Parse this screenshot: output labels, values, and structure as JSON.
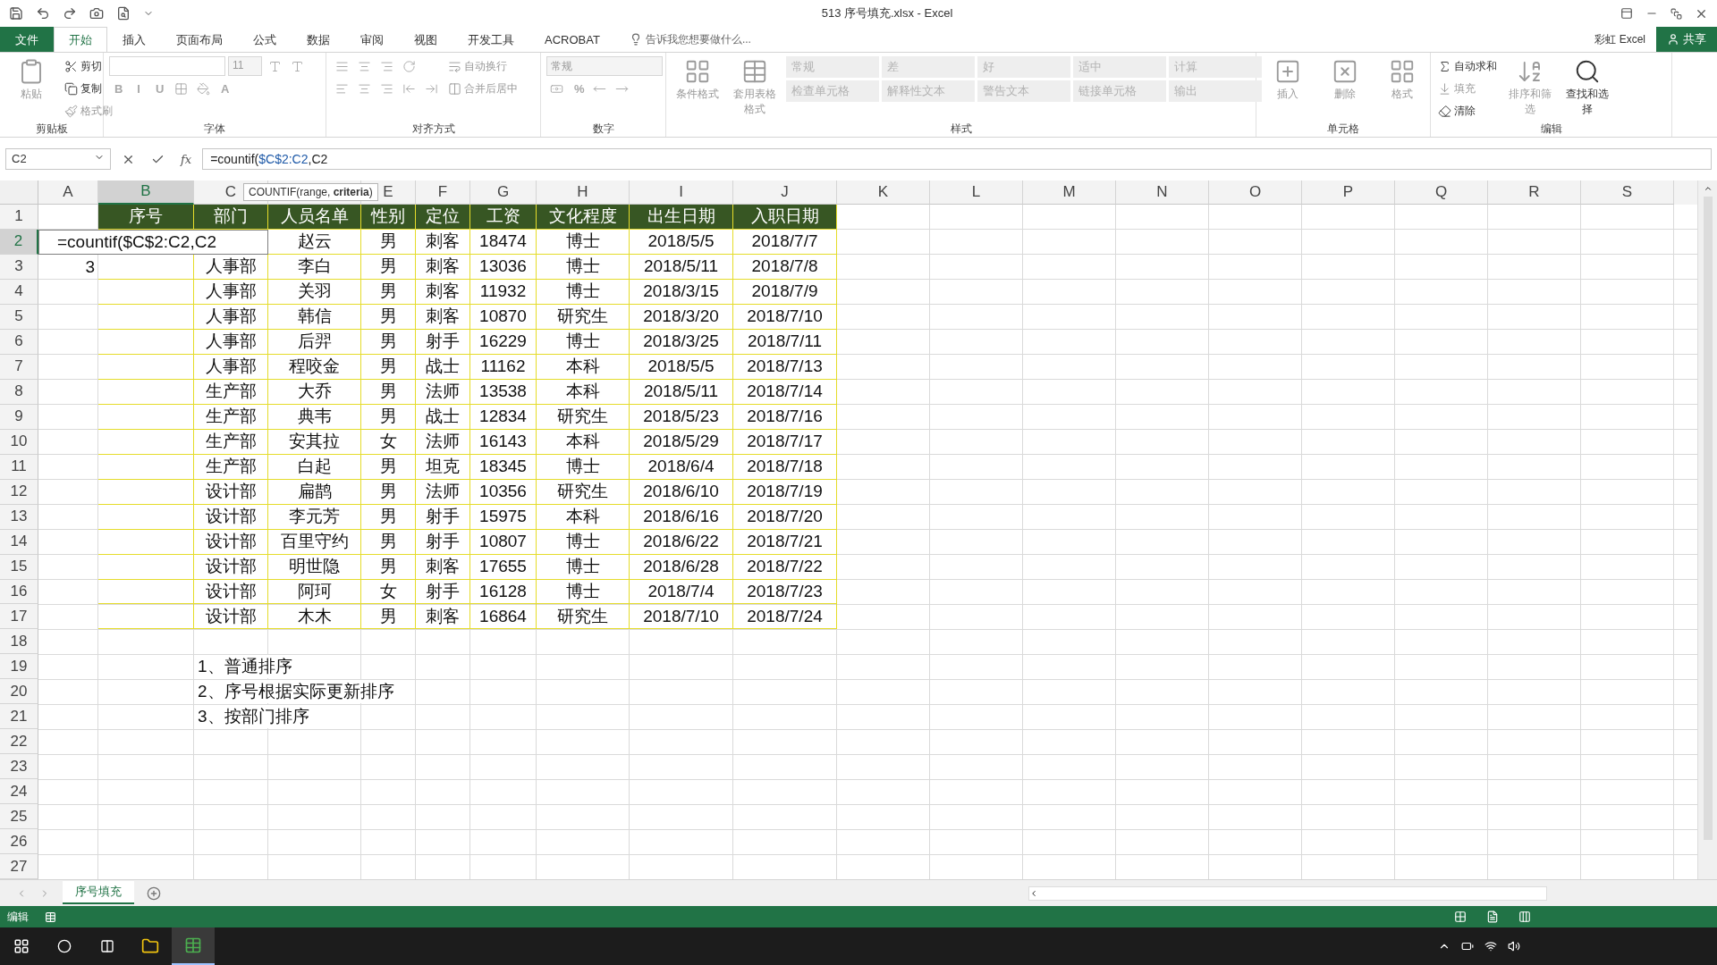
{
  "title": "513 序号填充.xlsx - Excel",
  "menu_tabs": [
    {
      "label": "文件",
      "kind": "file",
      "selected": false
    },
    {
      "label": "开始",
      "kind": "tab",
      "selected": true
    },
    {
      "label": "插入",
      "kind": "tab",
      "selected": false
    },
    {
      "label": "页面布局",
      "kind": "tab",
      "selected": false
    },
    {
      "label": "公式",
      "kind": "tab",
      "selected": false
    },
    {
      "label": "数据",
      "kind": "tab",
      "selected": false
    },
    {
      "label": "审阅",
      "kind": "tab",
      "selected": false
    },
    {
      "label": "视图",
      "kind": "tab",
      "selected": false
    },
    {
      "label": "开发工具",
      "kind": "tab",
      "selected": false
    },
    {
      "label": "ACROBAT",
      "kind": "tab",
      "selected": false
    }
  ],
  "tell_me": {
    "placeholder": "告诉我您想要做什么..."
  },
  "account": "彩虹 Excel",
  "share": "共享",
  "ribbon": [
    {
      "label": "剪贴板",
      "columns": [
        [
          [
            {
              "kind": "large",
              "label": "粘贴",
              "disabled": true
            }
          ]
        ],
        [
          [
            {
              "kind": "small",
              "label": "剪切",
              "disabled": false
            }
          ],
          [
            {
              "kind": "small",
              "label": "复制",
              "disabled": false
            }
          ],
          [
            {
              "kind": "small",
              "label": "格式刷",
              "disabled": true
            }
          ]
        ]
      ]
    },
    {
      "label": "字体",
      "columns": [
        [
          [
            {
              "kind": "field-wide"
            },
            {
              "kind": "field",
              "value": "11",
              "disabled": true
            },
            {
              "kind": "icon",
              "disabled": true
            },
            {
              "kind": "icon",
              "disabled": true
            }
          ],
          [
            {
              "kind": "char",
              "label": "B",
              "disabled": true
            },
            {
              "kind": "char",
              "label": "I",
              "disabled": true
            },
            {
              "kind": "char",
              "label": "U",
              "disabled": true
            },
            {
              "kind": "icon",
              "disabled": true
            },
            {
              "kind": "icon",
              "disabled": true
            },
            {
              "kind": "char",
              "label": "A",
              "disabled": true
            }
          ]
        ]
      ]
    },
    {
      "label": "对齐方式",
      "columns": [
        [
          [
            {
              "kind": "icon",
              "disabled": true
            },
            {
              "kind": "icon",
              "disabled": true
            },
            {
              "kind": "icon",
              "disabled": true
            },
            {
              "kind": "icon",
              "disabled": true
            }
          ],
          [
            {
              "kind": "icon",
              "disabled": true
            },
            {
              "kind": "icon",
              "disabled": true
            },
            {
              "kind": "icon",
              "disabled": true
            },
            {
              "kind": "icon",
              "disabled": true
            },
            {
              "kind": "icon",
              "disabled": true
            }
          ]
        ],
        [
          [
            {
              "kind": "small",
              "label": "自动换行",
              "disabled": true
            }
          ],
          [
            {
              "kind": "small",
              "label": "合并后居中",
              "disabled": true
            }
          ]
        ]
      ]
    },
    {
      "label": "数字",
      "columns": [
        [
          [
            {
              "kind": "field-wide",
              "value": "常规",
              "disabled": true
            }
          ],
          [
            {
              "kind": "icon",
              "disabled": true
            },
            {
              "kind": "char",
              "label": "%",
              "disabled": true
            },
            {
              "kind": "icon",
              "disabled": true
            },
            {
              "kind": "icon",
              "disabled": true
            }
          ]
        ]
      ]
    },
    {
      "label": "样式",
      "columns": [
        [
          [
            {
              "kind": "large",
              "label": "条件格式",
              "disabled": true
            }
          ]
        ],
        [
          [
            {
              "kind": "large",
              "label": "套用表格格式",
              "disabled": true
            }
          ]
        ],
        [
          [
            {
              "kind": "style",
              "label": "常规",
              "disabled": true
            },
            {
              "kind": "style",
              "label": "差",
              "disabled": true
            },
            {
              "kind": "style",
              "label": "好",
              "disabled": true
            },
            {
              "kind": "style",
              "label": "适中",
              "disabled": true
            },
            {
              "kind": "style",
              "label": "计算",
              "disabled": true
            }
          ],
          [
            {
              "kind": "style",
              "label": "检查单元格",
              "disabled": true
            },
            {
              "kind": "style",
              "label": "解释性文本",
              "disabled": true
            },
            {
              "kind": "style",
              "label": "警告文本",
              "disabled": true
            },
            {
              "kind": "style",
              "label": "链接单元格",
              "disabled": true
            },
            {
              "kind": "style",
              "label": "输出",
              "disabled": true
            }
          ]
        ]
      ]
    },
    {
      "label": "单元格",
      "columns": [
        [
          [
            {
              "kind": "large",
              "label": "插入",
              "disabled": true
            }
          ]
        ],
        [
          [
            {
              "kind": "large",
              "label": "删除",
              "disabled": true
            }
          ]
        ],
        [
          [
            {
              "kind": "large",
              "label": "格式",
              "disabled": true
            }
          ]
        ]
      ]
    },
    {
      "label": "编辑",
      "columns": [
        [
          [
            {
              "kind": "small",
              "label": "自动求和",
              "disabled": false
            }
          ],
          [
            {
              "kind": "small",
              "label": "填充",
              "disabled": true
            }
          ],
          [
            {
              "kind": "small",
              "label": "清除",
              "disabled": false
            }
          ]
        ],
        [
          [
            {
              "kind": "large",
              "label": "排序和筛选",
              "disabled": true
            }
          ]
        ],
        [
          [
            {
              "kind": "large",
              "label": "查找和选择",
              "disabled": false
            }
          ]
        ]
      ]
    }
  ],
  "name_box": {
    "value": "C2"
  },
  "formula": [
    {
      "text": "=countif(",
      "ref": false
    },
    {
      "text": "$C$2:C2",
      "ref": true
    },
    {
      "text": ",C2",
      "ref": false
    }
  ],
  "fx_label": "fx",
  "tooltip": "COUNTIF(range, **criteria**)",
  "columns": [
    {
      "letter": "A",
      "selected": false
    },
    {
      "letter": "B",
      "selected": true
    },
    {
      "letter": "C",
      "selected": false
    },
    {
      "selected": false
    },
    {
      "letter": "E",
      "selected": false
    },
    {
      "letter": "F",
      "selected": false
    },
    {
      "letter": "G",
      "selected": false
    },
    {
      "letter": "H",
      "selected": false
    },
    {
      "letter": "I",
      "selected": false
    },
    {
      "letter": "J",
      "selected": false
    },
    {
      "letter": "K",
      "selected": false
    },
    {
      "letter": "L",
      "selected": false
    },
    {
      "letter": "M",
      "selected": false
    },
    {
      "letter": "N",
      "selected": false
    },
    {
      "letter": "O",
      "selected": false
    },
    {
      "letter": "P",
      "selected": false
    },
    {
      "letter": "Q",
      "selected": false
    },
    {
      "letter": "R",
      "selected": false
    },
    {
      "letter": "S",
      "selected": false
    }
  ],
  "rows": [
    {
      "number": "1",
      "kind": "header",
      "selected": false,
      "cells": [
        null,
        "序号",
        "部门",
        "人员名单",
        "性别",
        "定位",
        "工资",
        "文化程度",
        "出生日期",
        "入职日期"
      ]
    },
    {
      "number": "2",
      "kind": "data",
      "selected": true,
      "edit": "=countif($C$2:C2,C2",
      "cells": [
        null,
        null,
        null,
        "赵云",
        "男",
        "刺客",
        "18474",
        "博士",
        "2018/5/5",
        "2018/7/7"
      ]
    },
    {
      "number": "3",
      "kind": "data",
      "selected": false,
      "cells": [
        "3",
        null,
        "人事部",
        "李白",
        "男",
        "刺客",
        "13036",
        "博士",
        "2018/5/11",
        "2018/7/8"
      ]
    },
    {
      "number": "4",
      "kind": "data",
      "selected": false,
      "cells": [
        null,
        null,
        "人事部",
        "关羽",
        "男",
        "刺客",
        "11932",
        "博士",
        "2018/3/15",
        "2018/7/9"
      ]
    },
    {
      "number": "5",
      "kind": "data",
      "selected": false,
      "cells": [
        null,
        null,
        "人事部",
        "韩信",
        "男",
        "刺客",
        "10870",
        "研究生",
        "2018/3/20",
        "2018/7/10"
      ]
    },
    {
      "number": "6",
      "kind": "data",
      "selected": false,
      "cells": [
        null,
        null,
        "人事部",
        "后羿",
        "男",
        "射手",
        "16229",
        "博士",
        "2018/3/25",
        "2018/7/11"
      ]
    },
    {
      "number": "7",
      "kind": "data",
      "selected": false,
      "cells": [
        null,
        null,
        "人事部",
        "程咬金",
        "男",
        "战士",
        "11162",
        "本科",
        "2018/5/5",
        "2018/7/13"
      ]
    },
    {
      "number": "8",
      "kind": "data",
      "selected": false,
      "cells": [
        null,
        null,
        "生产部",
        "大乔",
        "男",
        "法师",
        "13538",
        "本科",
        "2018/5/11",
        "2018/7/14"
      ]
    },
    {
      "number": "9",
      "kind": "data",
      "selected": false,
      "cells": [
        null,
        null,
        "生产部",
        "典韦",
        "男",
        "战士",
        "12834",
        "研究生",
        "2018/5/23",
        "2018/7/16"
      ]
    },
    {
      "number": "10",
      "kind": "data",
      "selected": false,
      "cells": [
        null,
        null,
        "生产部",
        "安其拉",
        "女",
        "法师",
        "16143",
        "本科",
        "2018/5/29",
        "2018/7/17"
      ]
    },
    {
      "number": "11",
      "kind": "data",
      "selected": false,
      "cells": [
        null,
        null,
        "生产部",
        "白起",
        "男",
        "坦克",
        "18345",
        "博士",
        "2018/6/4",
        "2018/7/18"
      ]
    },
    {
      "number": "12",
      "kind": "data",
      "selected": false,
      "cells": [
        null,
        null,
        "设计部",
        "扁鹊",
        "男",
        "法师",
        "10356",
        "研究生",
        "2018/6/10",
        "2018/7/19"
      ]
    },
    {
      "number": "13",
      "kind": "data",
      "selected": false,
      "cells": [
        null,
        null,
        "设计部",
        "李元芳",
        "男",
        "射手",
        "15975",
        "本科",
        "2018/6/16",
        "2018/7/20"
      ]
    },
    {
      "number": "14",
      "kind": "data",
      "selected": false,
      "cells": [
        null,
        null,
        "设计部",
        "百里守约",
        "男",
        "射手",
        "10807",
        "博士",
        "2018/6/22",
        "2018/7/21"
      ]
    },
    {
      "number": "15",
      "kind": "data",
      "selected": false,
      "cells": [
        null,
        null,
        "设计部",
        "明世隐",
        "男",
        "刺客",
        "17655",
        "博士",
        "2018/6/28",
        "2018/7/22"
      ]
    },
    {
      "number": "16",
      "kind": "data",
      "selected": false,
      "cells": [
        null,
        null,
        "设计部",
        "阿珂",
        "女",
        "射手",
        "16128",
        "博士",
        "2018/7/4",
        "2018/7/23"
      ]
    },
    {
      "number": "17",
      "kind": "data",
      "selected": false,
      "cells": [
        null,
        null,
        "设计部",
        "木木",
        "男",
        "刺客",
        "16864",
        "研究生",
        "2018/7/10",
        "2018/7/24"
      ]
    },
    {
      "number": "18",
      "kind": "plain",
      "selected": false
    },
    {
      "number": "19",
      "kind": "plain",
      "selected": false,
      "cells": [
        null,
        null,
        "1、普通排序"
      ]
    },
    {
      "number": "20",
      "kind": "plain",
      "selected": false,
      "cells": [
        null,
        null,
        "2、序号根据实际更新排序"
      ]
    },
    {
      "number": "21",
      "kind": "plain",
      "selected": false,
      "cells": [
        null,
        null,
        "3、按部门排序"
      ]
    },
    {
      "number": "22",
      "kind": "plain",
      "selected": false
    },
    {
      "number": "23",
      "kind": "plain",
      "selected": false
    },
    {
      "number": "24",
      "kind": "plain",
      "selected": false
    },
    {
      "number": "25",
      "kind": "plain",
      "selected": false
    },
    {
      "number": "26",
      "kind": "plain",
      "selected": false
    },
    {
      "number": "27",
      "kind": "plain",
      "selected": false
    }
  ],
  "sheet_tabs": [
    {
      "label": "序号填充",
      "selected": true
    }
  ],
  "status": "编辑"
}
